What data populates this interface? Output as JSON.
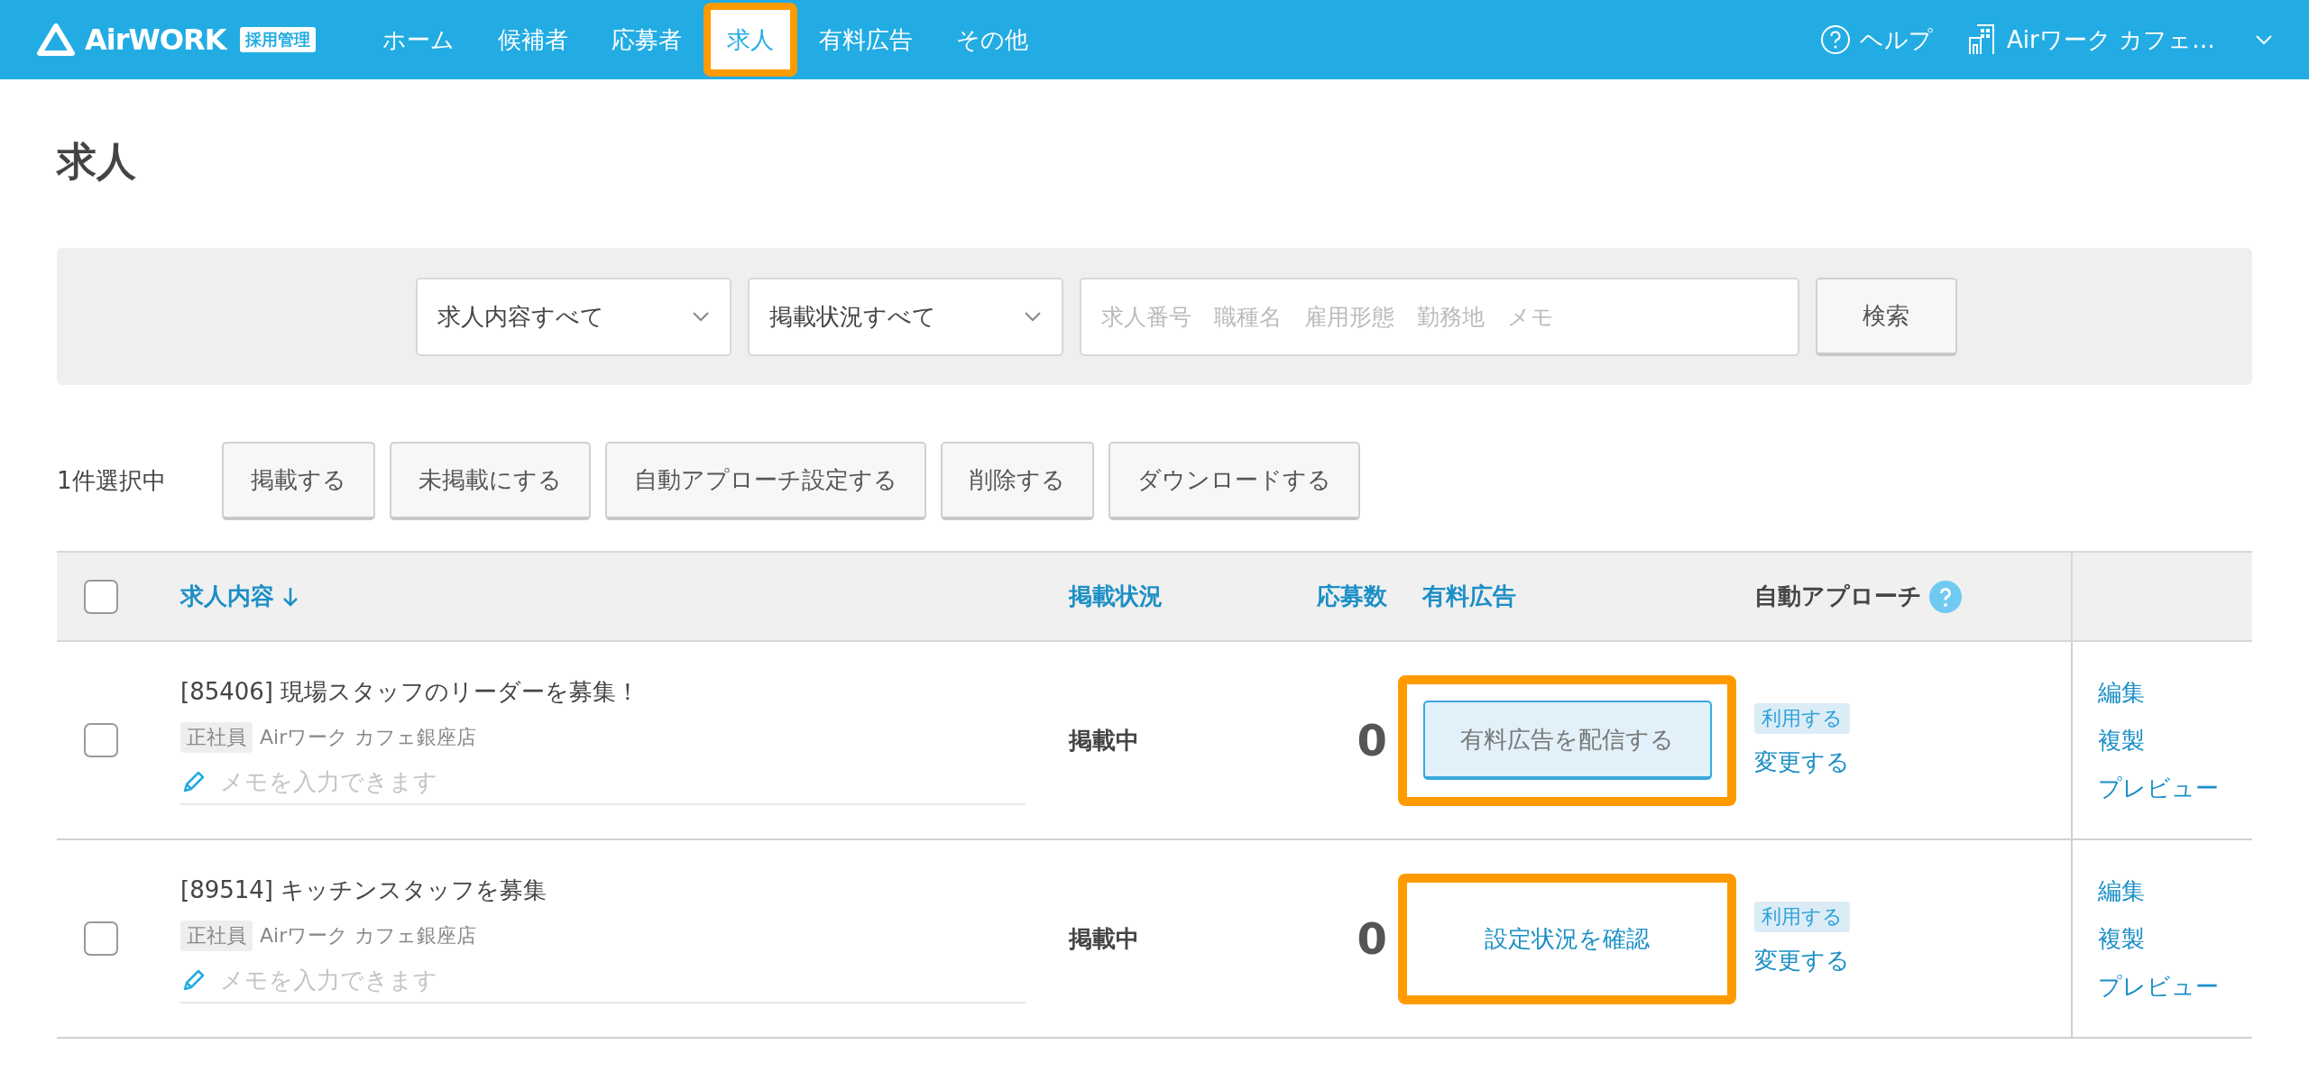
{
  "header": {
    "logo": "AirWORK",
    "logo_badge": "採用管理",
    "nav": [
      {
        "label": "ホーム",
        "selected": false,
        "highlighted": false
      },
      {
        "label": "候補者",
        "selected": false,
        "highlighted": false
      },
      {
        "label": "応募者",
        "selected": false,
        "highlighted": false
      },
      {
        "label": "求人",
        "selected": true,
        "highlighted": true
      },
      {
        "label": "有料広告",
        "selected": false,
        "highlighted": false
      },
      {
        "label": "その他",
        "selected": false,
        "highlighted": false
      }
    ],
    "help": "ヘルプ",
    "account": "Airワーク カフェ…"
  },
  "page_title": "求人",
  "filters": {
    "selects": [
      "求人内容すべて",
      "掲載状況すべて"
    ],
    "search_placeholder": "求人番号　職種名　雇用形態　勤務地　メモ",
    "search_button": "検索"
  },
  "bulk_actions": {
    "selection_count": "1件選択中",
    "buttons": [
      "掲載する",
      "未掲載にする",
      "自動アプローチ設定する",
      "削除する",
      "ダウンロードする"
    ]
  },
  "table": {
    "select_all_checked": false,
    "columns": [
      {
        "label": "求人内容",
        "sortable": true,
        "accent": true
      },
      {
        "label": "掲載状況",
        "sortable": false,
        "accent": true
      },
      {
        "label": "応募数",
        "sortable": false,
        "accent": true
      },
      {
        "label": "有料広告",
        "sortable": false,
        "accent": true
      },
      {
        "label": "自動アプローチ",
        "sortable": false,
        "accent": false
      }
    ],
    "rows": [
      {
        "checked": false,
        "title": "[85406] 現場スタッフのリーダーを募集！",
        "employment": "正社員",
        "store": "Airワーク カフェ銀座店",
        "memo_placeholder": "メモを入力できます",
        "status": "掲載中",
        "applicants": "0",
        "ad": {
          "kind": "button",
          "label": "有料広告を配信する",
          "highlighted": true
        },
        "auto_badge": "利用する",
        "auto_link": "変更する",
        "actions": [
          "編集",
          "複製",
          "プレビュー"
        ]
      },
      {
        "checked": false,
        "title": "[89514] キッチンスタッフを募集",
        "employment": "正社員",
        "store": "Airワーク カフェ銀座店",
        "memo_placeholder": "メモを入力できます",
        "status": "掲載中",
        "applicants": "0",
        "ad": {
          "kind": "link",
          "label": "設定状況を確認",
          "highlighted": true
        },
        "auto_badge": "利用する",
        "auto_link": "変更する",
        "actions": [
          "編集",
          "複製",
          "プレビュー"
        ]
      }
    ]
  }
}
